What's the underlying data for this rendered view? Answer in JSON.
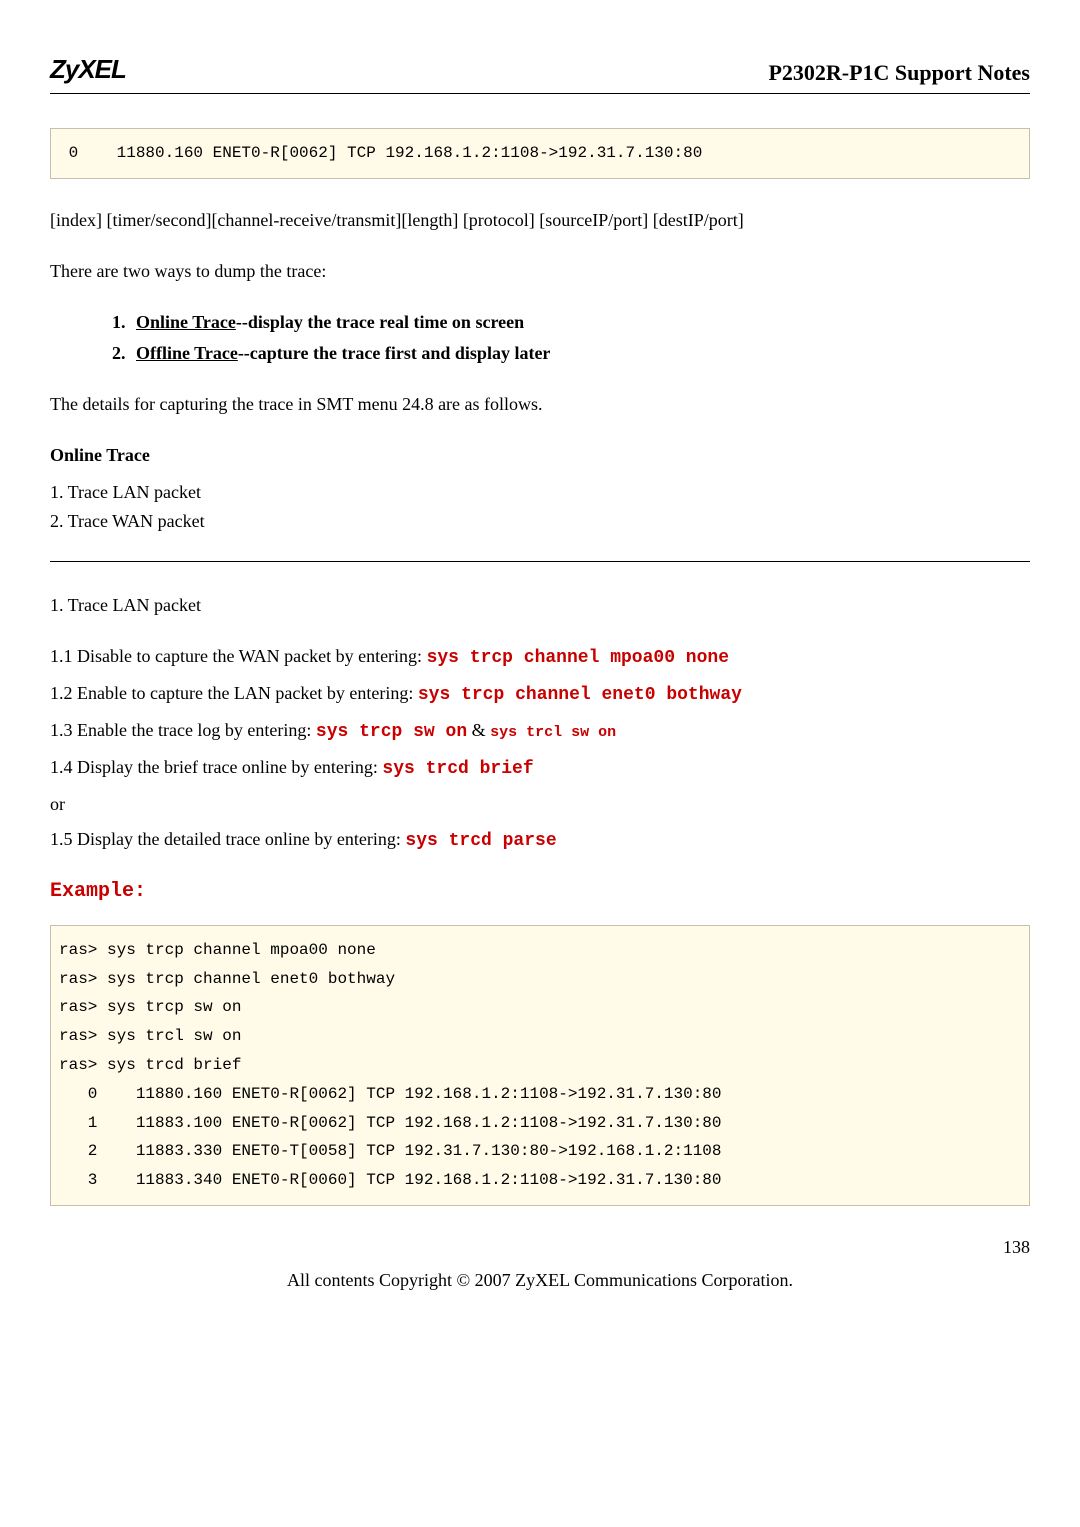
{
  "header": {
    "logo": "ZyXEL",
    "title": "P2302R-P1C Support Notes"
  },
  "top_code": " 0    11880.160 ENET0-R[0062] TCP 192.168.1.2:1108->192.31.7.130:80",
  "format_line": "[index] [timer/second][channel-receive/transmit][length]  [protocol] [sourceIP/port] [destIP/port]",
  "intro": "There are two ways to dump the trace:",
  "list": {
    "item1_link": "Online Trace",
    "item1_rest": "--display the trace real time on screen",
    "item2_link": "Offline Trace",
    "item2_rest": "--capture the trace first and display later"
  },
  "details_line": "The details for capturing the trace in SMT menu 24.8 are as follows.",
  "online_h": "Online Trace",
  "online_lines": {
    "l1": "1. Trace LAN packet",
    "l2": "2. Trace WAN packet"
  },
  "section1_h": "1. Trace LAN packet",
  "s1": {
    "l1_txt": "1.1 Disable to capture the WAN packet by entering: ",
    "l1_cmd": "sys trcp channel mpoa00 none",
    "l2_txt": "1.2 Enable to capture the LAN packet by entering: ",
    "l2_cmd": "sys trcp channel enet0 bothway",
    "l3_txt": "1.3 Enable the trace log by entering: ",
    "l3_cmd": "sys trcp sw on",
    "l3_amp": " & ",
    "l3_cmd2": "sys trcl sw on",
    "l4_txt": "1.4 Display the brief trace online by entering: ",
    "l4_cmd": "sys trcd brief",
    "or": "or",
    "l5_txt": "1.5 Display the detailed trace online by entering: ",
    "l5_cmd": "sys trcd parse"
  },
  "example_h": "Example:",
  "example_code": "ras> sys trcp channel mpoa00 none\nras> sys trcp channel enet0 bothway\nras> sys trcp sw on\nras> sys trcl sw on\nras> sys trcd brief\n   0    11880.160 ENET0-R[0062] TCP 192.168.1.2:1108->192.31.7.130:80\n   1    11883.100 ENET0-R[0062] TCP 192.168.1.2:1108->192.31.7.130:80\n   2    11883.330 ENET0-T[0058] TCP 192.31.7.130:80->192.168.1.2:1108\n   3    11883.340 ENET0-R[0060] TCP 192.168.1.2:1108->192.31.7.130:80",
  "page_num": "138",
  "footer": "All contents Copyright © 2007 ZyXEL Communications Corporation."
}
